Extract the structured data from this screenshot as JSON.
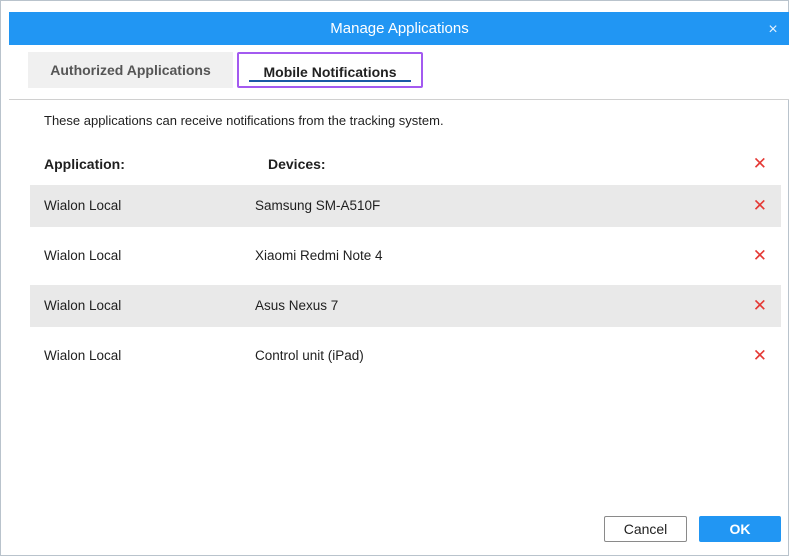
{
  "dialog": {
    "title": "Manage Applications",
    "close_glyph": "×",
    "accent_color": "#2196f3"
  },
  "tabs": [
    {
      "label": "Authorized Applications",
      "active": false
    },
    {
      "label": "Mobile Notifications",
      "active": true
    }
  ],
  "intro": "These applications can receive notifications from the tracking system.",
  "table": {
    "headers": {
      "application": "Application:",
      "devices": "Devices:"
    },
    "delete_glyph": "✕",
    "rows": [
      {
        "application": "Wialon Local",
        "device": "Samsung SM-A510F"
      },
      {
        "application": "Wialon Local",
        "device": "Xiaomi Redmi Note 4"
      },
      {
        "application": "Wialon Local",
        "device": "Asus Nexus 7"
      },
      {
        "application": "Wialon Local",
        "device": "Control unit (iPad)"
      }
    ]
  },
  "footer": {
    "cancel_label": "Cancel",
    "ok_label": "OK"
  }
}
